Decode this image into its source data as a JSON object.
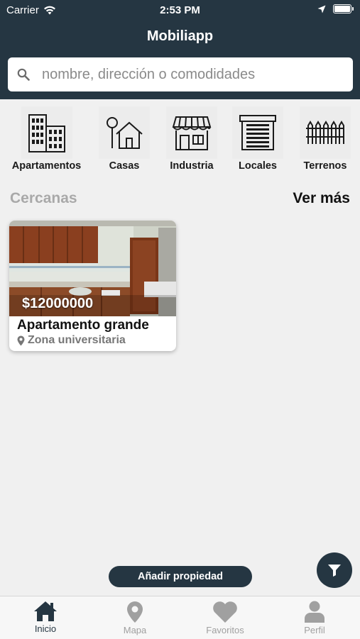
{
  "status_bar": {
    "carrier": "Carrier",
    "time": "2:53 PM"
  },
  "header": {
    "title": "Mobiliapp"
  },
  "search": {
    "placeholder": "nombre, dirección o comodidades",
    "icon": "search-icon"
  },
  "categories": [
    {
      "label": "Apartamentos",
      "icon": "apartment-building-icon"
    },
    {
      "label": "Casas",
      "icon": "house-icon"
    },
    {
      "label": "Industria",
      "icon": "storefront-icon"
    },
    {
      "label": "Locales",
      "icon": "garage-icon"
    },
    {
      "label": "Terrenos",
      "icon": "fence-icon"
    }
  ],
  "nearby": {
    "title": "Cercanas",
    "see_more": "Ver más",
    "listings": [
      {
        "price": "$12000000",
        "title": "Apartamento grande",
        "location": "Zona universitaria"
      }
    ]
  },
  "actions": {
    "add_property": "Añadir propiedad"
  },
  "tabs": [
    {
      "label": "Inicio",
      "icon": "home-icon",
      "active": true
    },
    {
      "label": "Mapa",
      "icon": "map-pin-icon",
      "active": false
    },
    {
      "label": "Favoritos",
      "icon": "heart-icon",
      "active": false
    },
    {
      "label": "Perfil",
      "icon": "user-icon",
      "active": false
    }
  ],
  "colors": {
    "header_bg": "#253642",
    "page_bg": "#f0f0f0",
    "active_tab": "#253642",
    "inactive_tab": "#a0a0a0"
  }
}
